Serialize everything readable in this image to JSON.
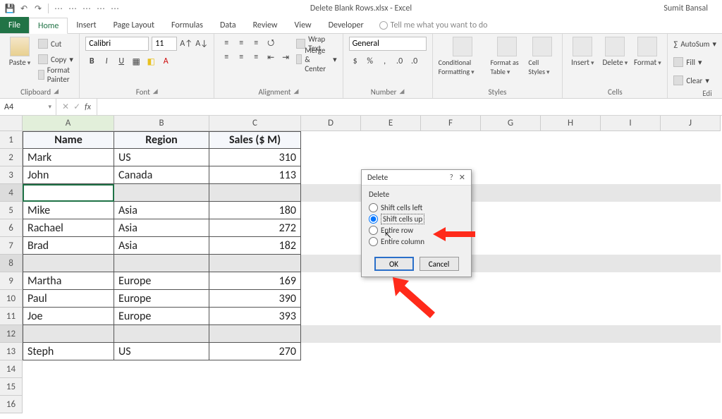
{
  "titlebar": {
    "title": "Delete Blank Rows.xlsx - Excel",
    "user": "Sumit Bansal"
  },
  "tabs": {
    "file": "File",
    "home": "Home",
    "insert": "Insert",
    "page_layout": "Page Layout",
    "formulas": "Formulas",
    "data": "Data",
    "review": "Review",
    "view": "View",
    "developer": "Developer",
    "tellme": "Tell me what you want to do"
  },
  "ribbon": {
    "clipboard": {
      "paste": "Paste",
      "cut": "Cut",
      "copy": "Copy",
      "format_painter": "Format Painter",
      "label": "Clipboard"
    },
    "font": {
      "name": "Calibri",
      "size": "11",
      "label": "Font"
    },
    "alignment": {
      "wrap": "Wrap Text",
      "merge": "Merge & Center",
      "label": "Alignment"
    },
    "number": {
      "format": "General",
      "label": "Number"
    },
    "styles": {
      "cond": "Conditional Formatting",
      "table": "Format as Table",
      "cell": "Cell Styles",
      "label": "Styles"
    },
    "cells": {
      "insert": "Insert",
      "delete": "Delete",
      "format": "Format",
      "label": "Cells"
    },
    "editing": {
      "autosum": "AutoSum",
      "fill": "Fill",
      "clear": "Clear",
      "label": "Editing"
    }
  },
  "namebox": "A4",
  "fx_label": "fx",
  "columns": [
    "A",
    "B",
    "C",
    "D",
    "E",
    "F",
    "G",
    "H",
    "I",
    "J"
  ],
  "headers": {
    "name": "Name",
    "region": "Region",
    "sales": "Sales ($ M)"
  },
  "rows": [
    {
      "n": 2,
      "name": "Mark",
      "region": "US",
      "sales": "310"
    },
    {
      "n": 3,
      "name": "John",
      "region": "Canada",
      "sales": "113"
    },
    {
      "n": 4,
      "name": "",
      "region": "",
      "sales": "",
      "blank": true
    },
    {
      "n": 5,
      "name": "Mike",
      "region": "Asia",
      "sales": "180"
    },
    {
      "n": 6,
      "name": "Rachael",
      "region": "Asia",
      "sales": "272"
    },
    {
      "n": 7,
      "name": "Brad",
      "region": "Asia",
      "sales": "182"
    },
    {
      "n": 8,
      "name": "",
      "region": "",
      "sales": "",
      "blank": true
    },
    {
      "n": 9,
      "name": "Martha",
      "region": "Europe",
      "sales": "169"
    },
    {
      "n": 10,
      "name": "Paul",
      "region": "Europe",
      "sales": "390"
    },
    {
      "n": 11,
      "name": "Joe",
      "region": "Europe",
      "sales": "393"
    },
    {
      "n": 12,
      "name": "",
      "region": "",
      "sales": "",
      "blank": true
    },
    {
      "n": 13,
      "name": "Steph",
      "region": "US",
      "sales": "270"
    }
  ],
  "dialog": {
    "title": "Delete",
    "group": "Delete",
    "opt_left": "Shift cells left",
    "opt_up": "Shift cells up",
    "opt_row": "Entire row",
    "opt_col": "Entire column",
    "ok": "OK",
    "cancel": "Cancel",
    "selected": "opt_up"
  }
}
